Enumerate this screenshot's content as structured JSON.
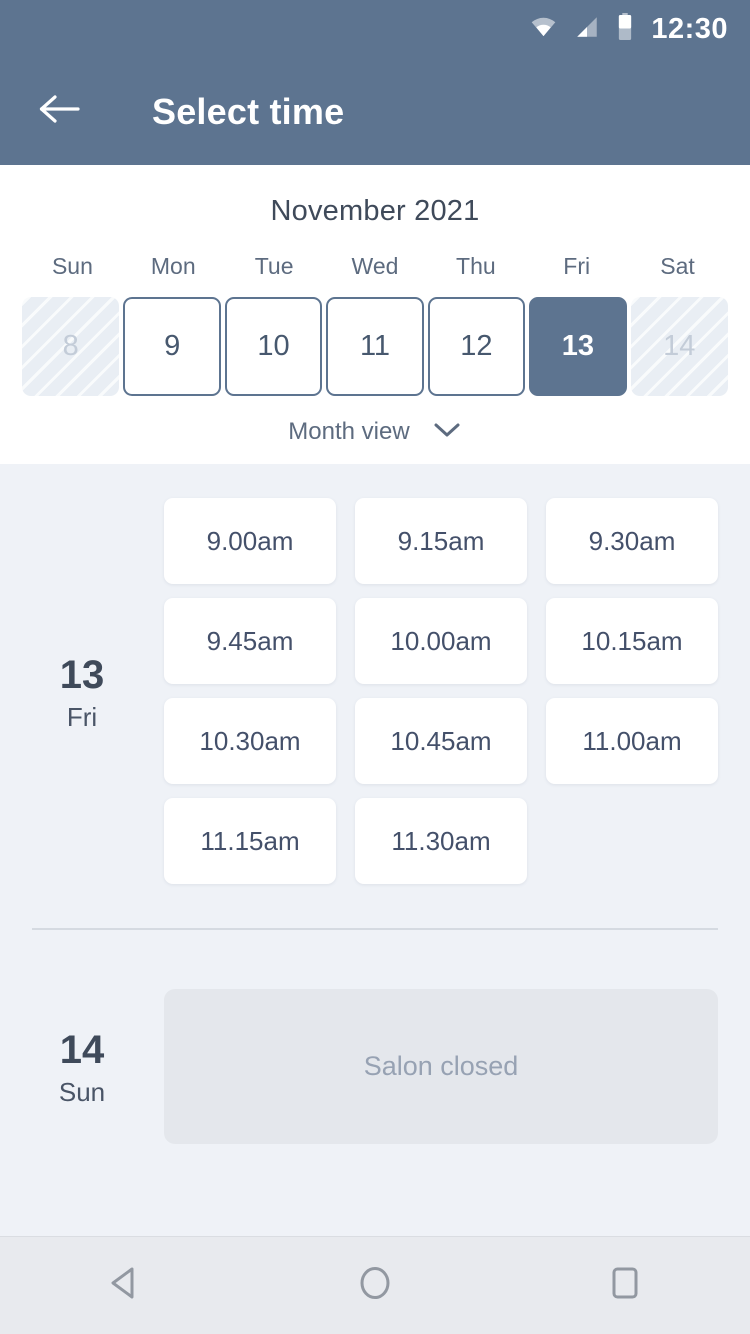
{
  "status_bar": {
    "time": "12:30",
    "icons": [
      "wifi-icon",
      "signal-icon",
      "battery-icon"
    ]
  },
  "app_bar": {
    "back_icon": "back-arrow-icon",
    "title": "Select time"
  },
  "calendar": {
    "month_title": "November 2021",
    "weekdays": [
      "Sun",
      "Mon",
      "Tue",
      "Wed",
      "Thu",
      "Fri",
      "Sat"
    ],
    "dates": [
      {
        "day": "8",
        "state": "disabled"
      },
      {
        "day": "9",
        "state": "available"
      },
      {
        "day": "10",
        "state": "available"
      },
      {
        "day": "11",
        "state": "available"
      },
      {
        "day": "12",
        "state": "available"
      },
      {
        "day": "13",
        "state": "selected"
      },
      {
        "day": "14",
        "state": "disabled"
      }
    ],
    "month_view_label": "Month view",
    "month_view_icon": "chevron-down-icon"
  },
  "schedule": [
    {
      "day_number": "13",
      "day_of_week": "Fri",
      "slots": [
        "9.00am",
        "9.15am",
        "9.30am",
        "9.45am",
        "10.00am",
        "10.15am",
        "10.30am",
        "10.45am",
        "11.00am",
        "11.15am",
        "11.30am"
      ]
    },
    {
      "day_number": "14",
      "day_of_week": "Sun",
      "closed_message": "Salon closed"
    }
  ],
  "nav_bar": {
    "back_icon": "nav-back-triangle-icon",
    "home_icon": "nav-home-circle-icon",
    "recents_icon": "nav-recents-square-icon"
  },
  "colors": {
    "accent": "#5d7490",
    "page_background": "#eff2f7",
    "panel": "#ffffff",
    "text_dark": "#3f4a5a",
    "text_muted": "#5d6b7f",
    "disabled_cell": "#e9eef4",
    "closed_card": "#e4e7ec",
    "nav_bar": "#e8eaee"
  }
}
